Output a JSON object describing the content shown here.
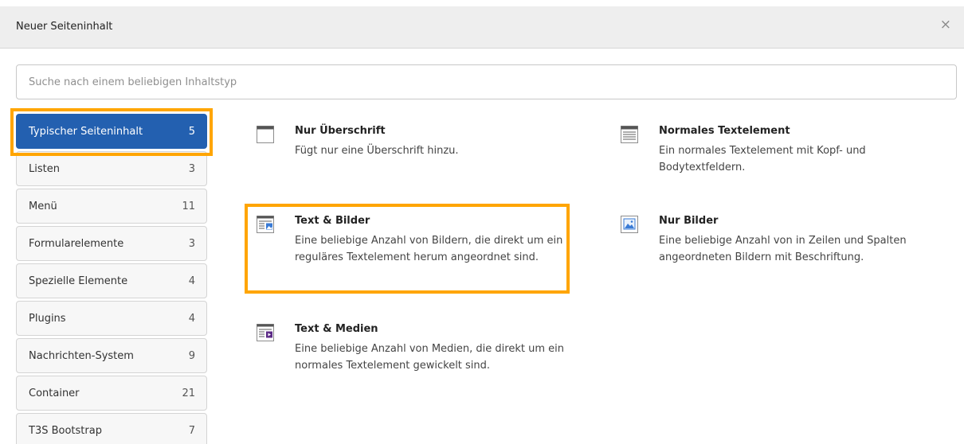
{
  "modal": {
    "title": "Neuer Seiteninhalt",
    "close_symbol": "×"
  },
  "search": {
    "placeholder": "Suche nach einem beliebigen Inhaltstyp"
  },
  "tabs": [
    {
      "label": "Typischer Seiteninhalt",
      "count": "5",
      "active": true
    },
    {
      "label": "Listen",
      "count": "3"
    },
    {
      "label": "Menü",
      "count": "11"
    },
    {
      "label": "Formularelemente",
      "count": "3"
    },
    {
      "label": "Spezielle Elemente",
      "count": "4"
    },
    {
      "label": "Plugins",
      "count": "4"
    },
    {
      "label": "Nachrichten-System",
      "count": "9"
    },
    {
      "label": "Container",
      "count": "21"
    },
    {
      "label": "T3S Bootstrap",
      "count": "7"
    }
  ],
  "items": [
    {
      "title": "Nur Überschrift",
      "description": "Fügt nur eine Überschrift hinzu.",
      "icon": "header-icon"
    },
    {
      "title": "Normales Textelement",
      "description": "Ein normales Textelement mit Kopf- und Bodytextfeldern.",
      "icon": "text-icon"
    },
    {
      "title": "Text & Bilder",
      "description": "Eine beliebige Anzahl von Bildern, die direkt um ein reguläres Textelement herum angeordnet sind.",
      "icon": "textpic-icon"
    },
    {
      "title": "Nur Bilder",
      "description": "Eine beliebige Anzahl von in Zeilen und Spalten angeordneten Bildern mit Beschriftung.",
      "icon": "images-icon"
    },
    {
      "title": "Text & Medien",
      "description": "Eine beliebige Anzahl von Medien, die direkt um ein normales Textelement gewickelt sind.",
      "icon": "textmedia-icon"
    }
  ],
  "colors": {
    "active_tab": "#2360b0",
    "highlight": "#ffa500",
    "header_bg": "#eeeeee",
    "media_accent": "#5b2a86",
    "image_accent": "#3a7bd5"
  }
}
